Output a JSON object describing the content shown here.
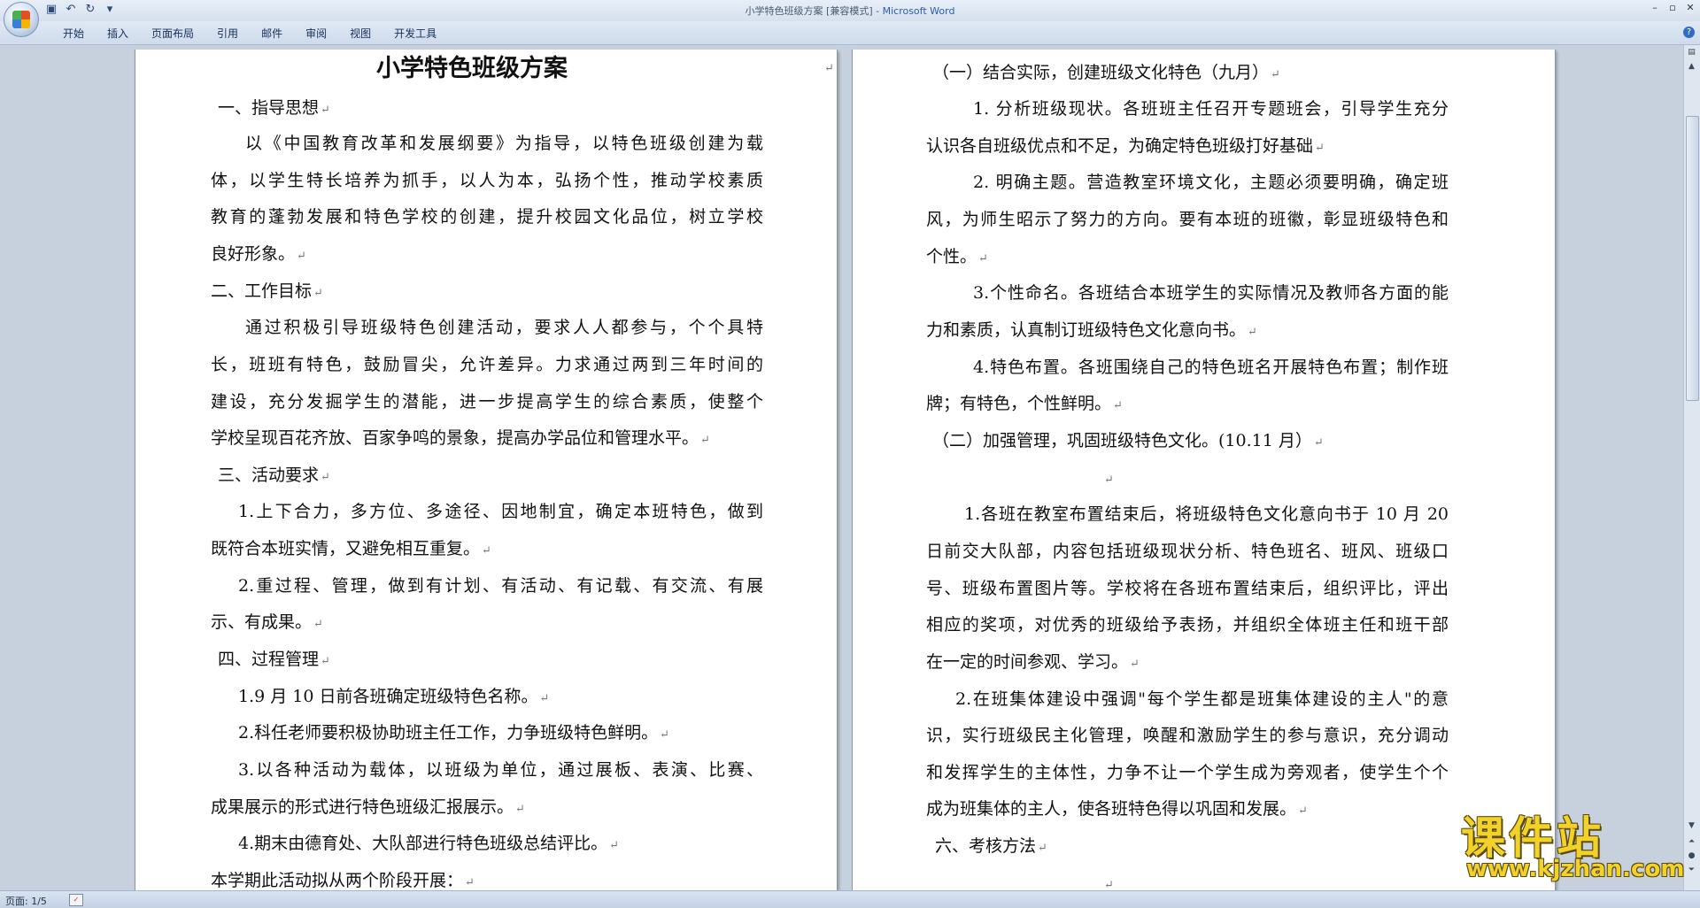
{
  "window": {
    "title_doc": "小学特色班级方案 [兼容模式] - ",
    "title_app": "Microsoft Word"
  },
  "quick_access": {
    "icons": [
      "save-icon",
      "undo-icon",
      "redo-icon",
      "customize-icon"
    ]
  },
  "ribbon": {
    "tabs": [
      "开始",
      "插入",
      "页面布局",
      "引用",
      "邮件",
      "审阅",
      "视图",
      "开发工具"
    ]
  },
  "document": {
    "title": "小学特色班级方案",
    "page1_lines": [
      "一、指导思想",
      "以《中国教育改革和发展纲要》为指导，以特色班级创建为载",
      "体，以学生特长培养为抓手，以人为本，弘扬个性，推动学校素质",
      "教育的蓬勃发展和特色学校的创建，提升校园文化品位，树立学校",
      "良好形象。",
      "二、工作目标",
      "通过积极引导班级特色创建活动，要求人人都参与，个个具特",
      "长，班班有特色，鼓励冒尖，允许差异。力求通过两到三年时间的",
      "建设，充分发掘学生的潜能，进一步提高学生的综合素质，使整个",
      "学校呈现百花齐放、百家争鸣的景象，提高办学品位和管理水平。",
      "三、活动要求",
      "1.上下合力，多方位、多途径、因地制宜，确定本班特色，做到",
      "既符合本班实情，又避免相互重复。",
      "2.重过程、管理，做到有计划、有活动、有记载、有交流、有展",
      "示、有成果。",
      "四、过程管理",
      "1.9 月 10 日前各班确定班级特色名称。",
      "2.科任老师要积极协助班主任工作，力争班级特色鲜明。",
      "3.以各种活动为载体，以班级为单位，通过展板、表演、比赛、",
      "成果展示的形式进行特色班级汇报展示。",
      "4.期末由德育处、大队部进行特色班级总结评比。",
      "本学期此活动拟从两个阶段开展："
    ],
    "page2_lines": [
      "（一）结合实际，创建班级文化特色（九月）",
      "1.  分析班级现状。各班班主任召开专题班会，引导学生充分",
      "认识各自班级优点和不足，为确定特色班级打好基础",
      "2.  明确主题。营造教室环境文化，主题必须要明确，确定班",
      "风，为师生昭示了努力的方向。要有本班的班徽，彰显班级特色和",
      "个性。",
      "3.个性命名。各班结合本班学生的实际情况及教师各方面的能",
      "力和素质，认真制订班级特色文化意向书。",
      "4.特色布置。各班围绕自己的特色班名开展特色布置；制作班",
      "牌；有特色，个性鲜明。",
      "（二）加强管理，巩固班级特色文化。(10.11 月）",
      "",
      "1.各班在教室布置结束后，将班级特色文化意向书于 10 月 20",
      "日前交大队部，内容包括班级现状分析、特色班名、班风、班级口",
      "号、班级布置图片等。学校将在各班布置结束后，组织评比，评出",
      "相应的奖项，对优秀的班级给予表扬，并组织全体班主任和班干部",
      "在一定的时间参观、学习。",
      "2.在班集体建设中强调\"每个学生都是班集体建设的主人\"的意",
      "识，实行班级民主化管理，唤醒和激励学生的参与意识，充分调动",
      "和发挥学生的主体性，力争不让一个学生成为旁观者，使学生个个",
      "成为班集体的主人，使各班特色得以巩固和发展。",
      "六、考核方法",
      ""
    ],
    "paragraph_mark": "↵"
  },
  "watermark": {
    "main": "课件站",
    "url": "www.kjzhan.com"
  },
  "status": {
    "page": "页面: 1/5"
  }
}
